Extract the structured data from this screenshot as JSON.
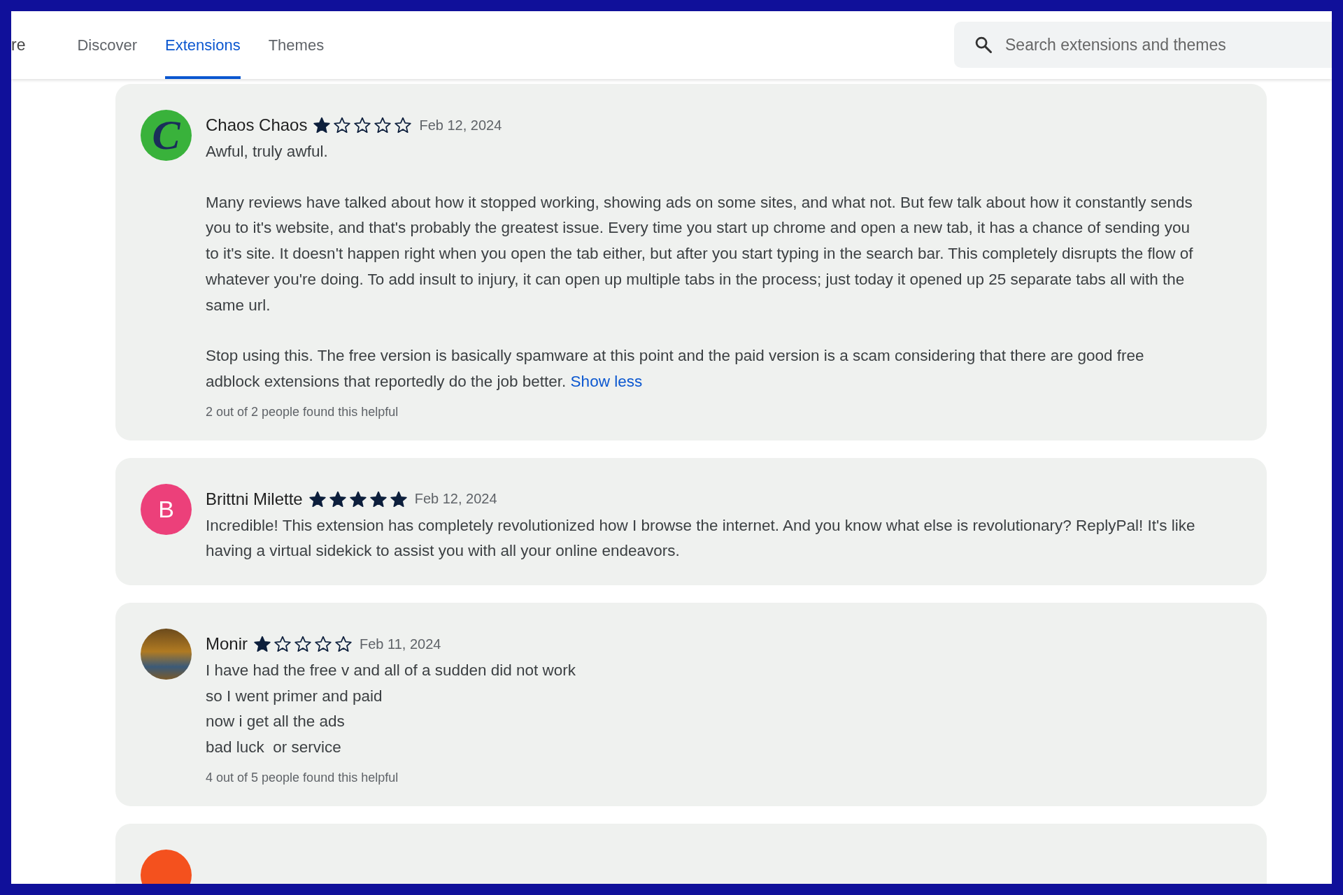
{
  "header": {
    "brand": "re",
    "tabs": [
      {
        "label": "Discover",
        "selected": false
      },
      {
        "label": "Extensions",
        "selected": true
      },
      {
        "label": "Themes",
        "selected": false
      }
    ],
    "search": {
      "placeholder": "Search extensions and themes"
    }
  },
  "reviews": [
    {
      "avatar": {
        "kind": "logo",
        "letter": "C",
        "color": "#39b23b"
      },
      "name": "Chaos Chaos",
      "stars": 1,
      "date": "Feb 12, 2024",
      "paragraphs": [
        "Awful, truly awful.",
        "Many reviews have talked about how it stopped working, showing ads on some sites, and what not. But few talk about how it constantly sends you to it's website, and that's probably the greatest issue. Every time you start up chrome and open a new tab, it has a chance of sending you to it's site. It doesn't happen right when you open the tab either, but after you start typing in the search bar. This completely disrupts the flow of whatever you're doing. To add insult to injury, it can open up multiple tabs in the process; just today it opened up 25 separate tabs all with the same url.",
        "Stop using this. The free version is basically spamware at this point and the paid version is a scam considering that there are good free adblock extensions that reportedly do the job better."
      ],
      "link": "Show less",
      "helpful": "2 out of 2 people found this helpful"
    },
    {
      "avatar": {
        "kind": "letter",
        "letter": "B",
        "color": "#ec407a"
      },
      "name": "Brittni Milette",
      "stars": 5,
      "date": "Feb 12, 2024",
      "paragraphs": [
        "Incredible! This extension has completely revolutionized how I browse the internet. And you know what else is revolutionary? ReplyPal! It's like having a virtual sidekick to assist you with all your online endeavors."
      ]
    },
    {
      "avatar": {
        "kind": "photo"
      },
      "name": "Monir",
      "stars": 1,
      "date": "Feb 11, 2024",
      "paragraphs": [
        "I have had the free v and all of a sudden did not work\nso I went primer and paid\nnow i get all the ads\nbad luck  or service"
      ],
      "helpful": "4 out of 5 people found this helpful"
    },
    {
      "avatar": {
        "kind": "letter",
        "color": "#f4511e"
      }
    }
  ]
}
